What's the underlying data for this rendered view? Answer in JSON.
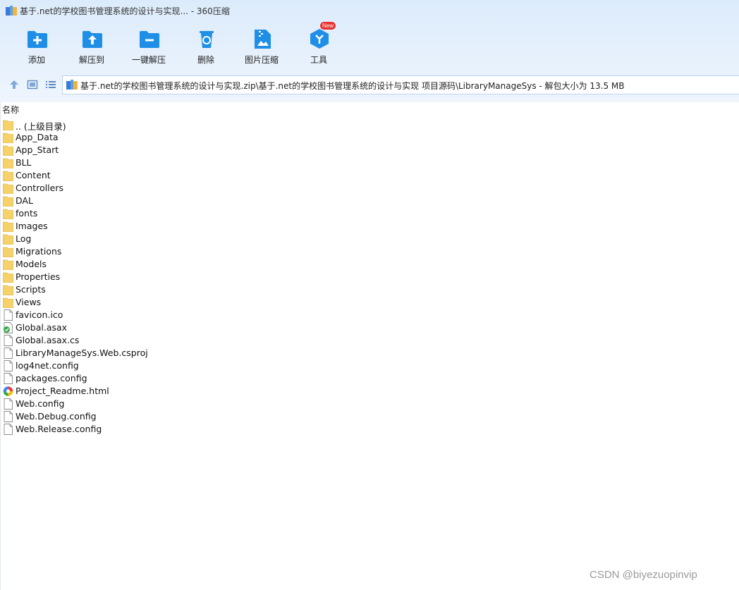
{
  "window": {
    "title": "基于.net的学校图书管理系统的设计与实现... - 360压缩"
  },
  "toolbar": [
    {
      "name": "add",
      "label": "添加",
      "icon": "folder-plus-icon"
    },
    {
      "name": "extract-to",
      "label": "解压到",
      "icon": "folder-upload-icon"
    },
    {
      "name": "one-click-extract",
      "label": "一键解压",
      "icon": "folder-minus-icon"
    },
    {
      "name": "delete",
      "label": "删除",
      "icon": "recycle-bin-icon"
    },
    {
      "name": "image-compress",
      "label": "图片压缩",
      "icon": "image-zip-icon"
    },
    {
      "name": "tools",
      "label": "工具",
      "icon": "tools-cube-icon",
      "badge": "New"
    }
  ],
  "address": {
    "path": "基于.net的学校图书管理系统的设计与实现.zip\\基于.net的学校图书管理系统的设计与实现 项目源码\\LibraryManageSys - 解包大小为 13.5 MB"
  },
  "list": {
    "column_name": "名称",
    "items": [
      {
        "name": ".. (上级目录)",
        "type": "folder"
      },
      {
        "name": "App_Data",
        "type": "folder"
      },
      {
        "name": "App_Start",
        "type": "folder"
      },
      {
        "name": "BLL",
        "type": "folder"
      },
      {
        "name": "Content",
        "type": "folder"
      },
      {
        "name": "Controllers",
        "type": "folder"
      },
      {
        "name": "DAL",
        "type": "folder"
      },
      {
        "name": "fonts",
        "type": "folder"
      },
      {
        "name": "Images",
        "type": "folder"
      },
      {
        "name": "Log",
        "type": "folder"
      },
      {
        "name": "Migrations",
        "type": "folder"
      },
      {
        "name": "Models",
        "type": "folder"
      },
      {
        "name": "Properties",
        "type": "folder"
      },
      {
        "name": "Scripts",
        "type": "folder"
      },
      {
        "name": "Views",
        "type": "folder"
      },
      {
        "name": "favicon.ico",
        "type": "file"
      },
      {
        "name": "Global.asax",
        "type": "asax"
      },
      {
        "name": "Global.asax.cs",
        "type": "file"
      },
      {
        "name": "LibraryManageSys.Web.csproj",
        "type": "file"
      },
      {
        "name": "log4net.config",
        "type": "file"
      },
      {
        "name": "packages.config",
        "type": "file"
      },
      {
        "name": "Project_Readme.html",
        "type": "html"
      },
      {
        "name": "Web.config",
        "type": "file"
      },
      {
        "name": "Web.Debug.config",
        "type": "file"
      },
      {
        "name": "Web.Release.config",
        "type": "file"
      }
    ]
  },
  "watermark": "CSDN @biyezuopinvip",
  "colors": {
    "accent": "#1e8ee6",
    "folder": "#f6d26b",
    "badge": "#e8312f",
    "toolbar_bg": "#dcebfb"
  }
}
